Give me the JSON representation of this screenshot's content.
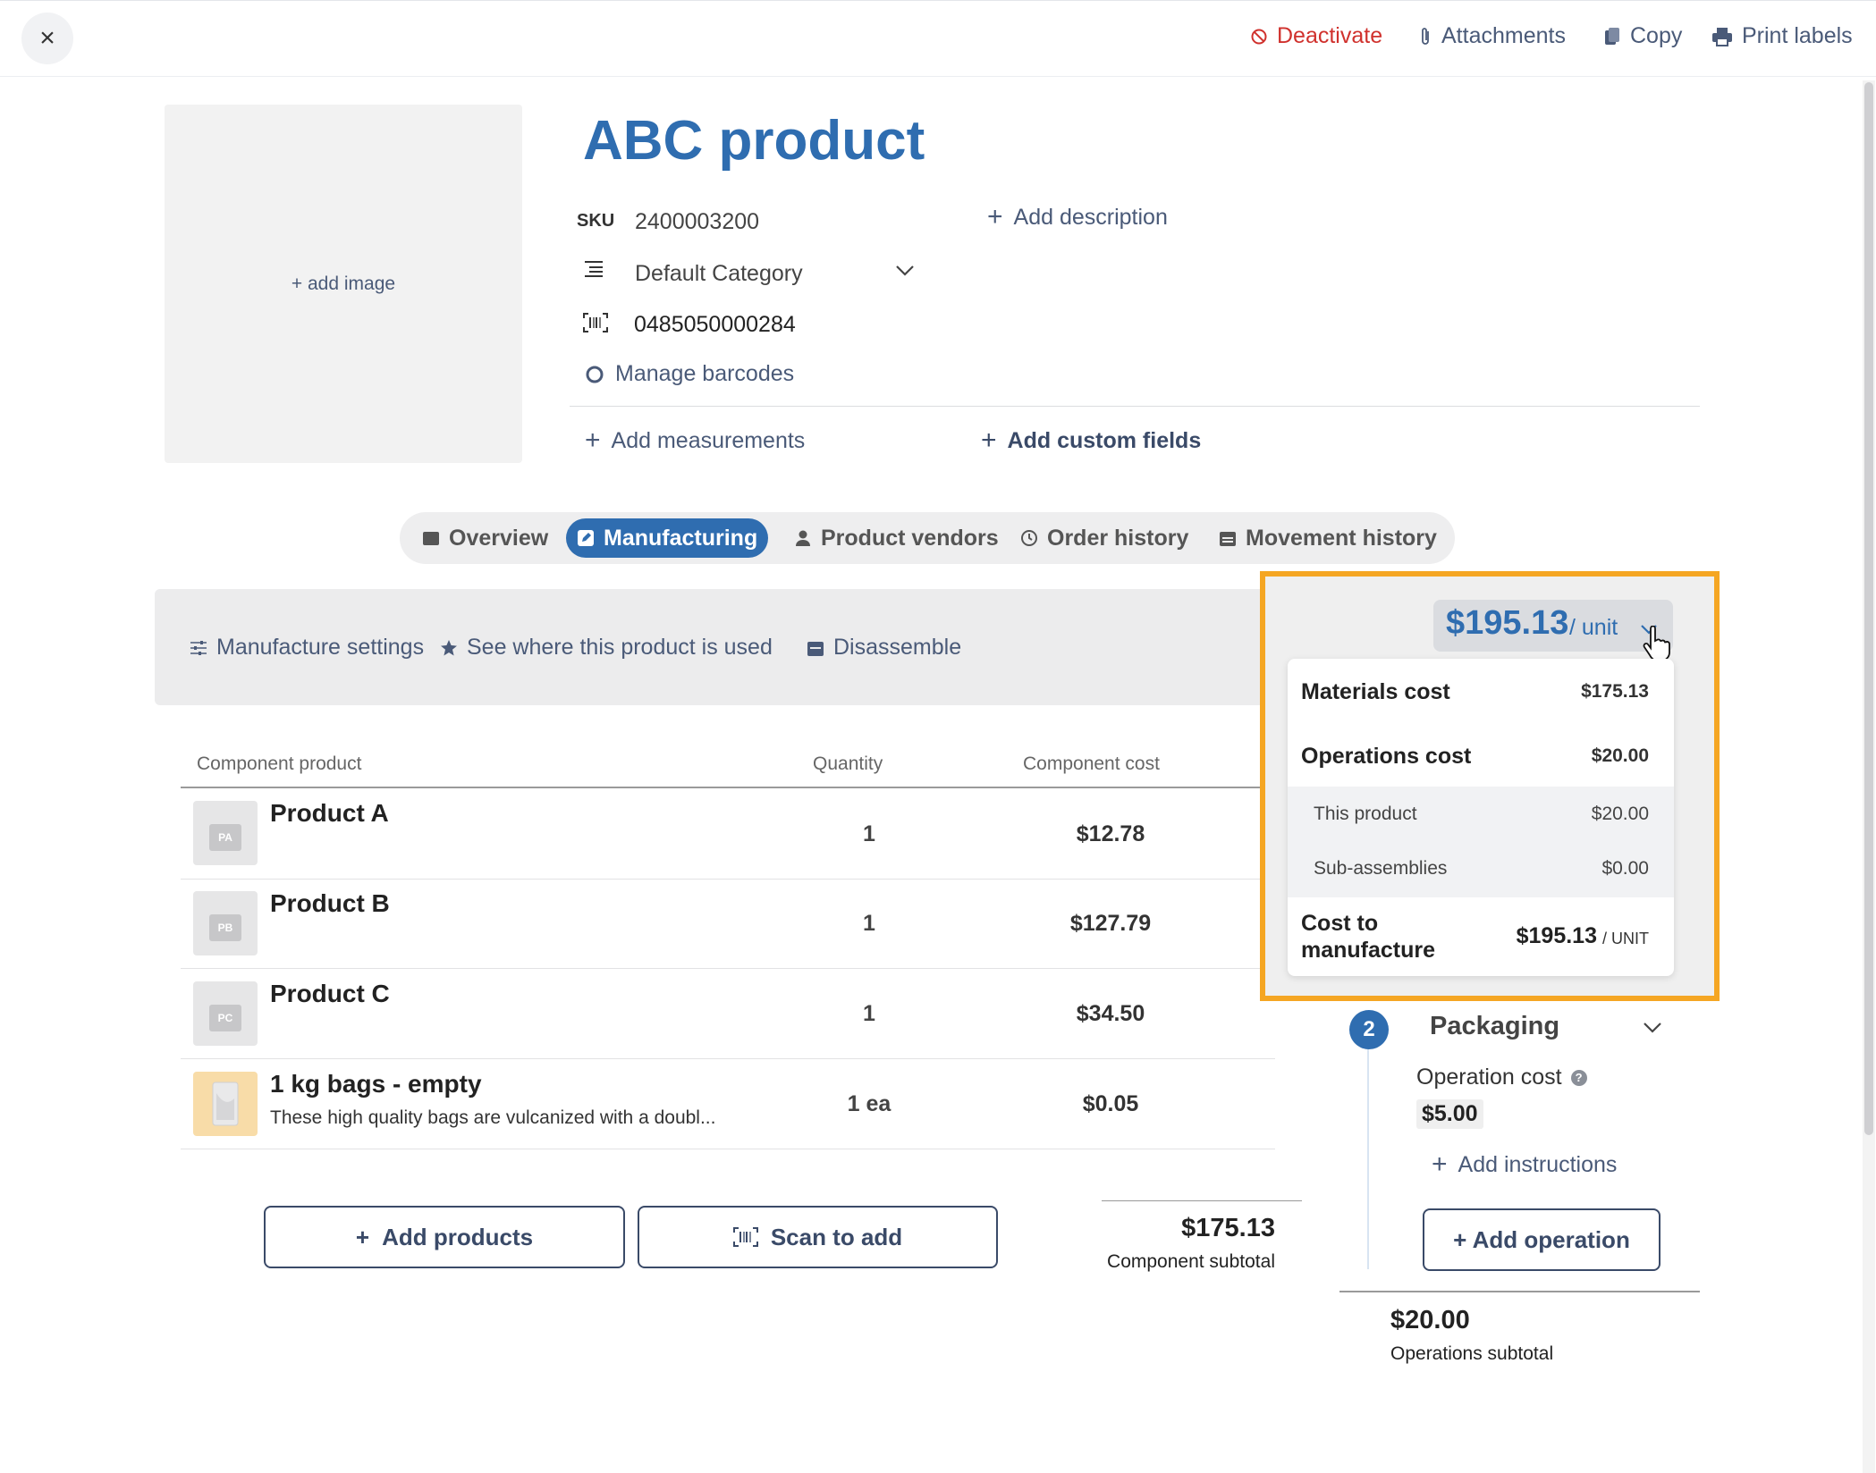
{
  "topbar": {
    "close_symbol": "×",
    "deactivate": "Deactivate",
    "attachments": "Attachments",
    "copy": "Copy",
    "print_labels": "Print labels"
  },
  "product": {
    "image_placeholder": "+ add image",
    "title": "ABC product",
    "sku_label": "SKU",
    "sku": "2400003200",
    "category": "Default Category",
    "barcode": "0485050000284",
    "manage_barcodes": "Manage barcodes",
    "add_description": "Add description",
    "add_measurements": "Add measurements",
    "add_custom_fields": "Add custom fields"
  },
  "tabs": [
    {
      "label": "Overview",
      "icon": "folder-icon"
    },
    {
      "label": "Manufacturing",
      "icon": "edit-icon",
      "active": true
    },
    {
      "label": "Product vendors",
      "icon": "person-icon"
    },
    {
      "label": "Order history",
      "icon": "clock-icon"
    },
    {
      "label": "Movement history",
      "icon": "calendar-icon"
    }
  ],
  "settings": {
    "manufacture_settings": "Manufacture settings",
    "see_where_used": "See where this product is used",
    "disassemble": "Disassemble"
  },
  "table": {
    "headers": [
      "Component product",
      "Quantity",
      "Component cost"
    ],
    "rows": [
      {
        "thumb": "PA",
        "name": "Product A",
        "description": "",
        "quantity": "1",
        "cost": "$12.78"
      },
      {
        "thumb": "PB",
        "name": "Product B",
        "description": "",
        "quantity": "1",
        "cost": "$127.79"
      },
      {
        "thumb": "PC",
        "name": "Product C",
        "description": "",
        "quantity": "1",
        "cost": "$34.50"
      },
      {
        "thumb": "",
        "name": "1 kg bags - empty",
        "description": "These high quality bags are vulcanized with a doubl...",
        "quantity": "1 ea",
        "cost": "$0.05"
      }
    ],
    "add_products": "Add products",
    "scan_to_add": "Scan to add",
    "component_subtotal_value": "$175.13",
    "component_subtotal_label": "Component subtotal"
  },
  "cost_summary": {
    "price": "$195.13",
    "per_unit": "/ unit",
    "materials_cost_label": "Materials cost",
    "materials_cost": "$175.13",
    "operations_cost_label": "Operations cost",
    "operations_cost": "$20.00",
    "this_product_label": "This product",
    "this_product": "$20.00",
    "sub_assemblies_label": "Sub-assemblies",
    "sub_assemblies": "$0.00",
    "cost_to_manufacture_label_1": "Cost to",
    "cost_to_manufacture_label_2": "manufacture",
    "cost_to_manufacture": "$195.13",
    "cost_unit": "/ UNIT"
  },
  "operations": {
    "step_number": "2",
    "step_name": "Packaging",
    "operation_cost_label": "Operation cost",
    "operation_cost": "$5.00",
    "add_instructions": "Add instructions",
    "add_operation": "+ Add operation",
    "operations_subtotal_value": "$20.00",
    "operations_subtotal_label": "Operations subtotal"
  },
  "colors": {
    "accent": "#2f6db0",
    "danger": "#d0312d",
    "highlight": "#f5a623"
  }
}
